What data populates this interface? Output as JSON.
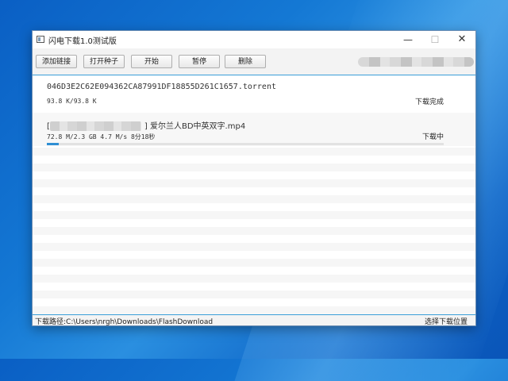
{
  "window": {
    "title": "闪电下载1.0测试版",
    "minimize_glyph": "—",
    "maximize_glyph": "☐",
    "close_glyph": "✕"
  },
  "toolbar": {
    "buttons": [
      "添加链接",
      "打开种子",
      "开始",
      "暂停",
      "删除"
    ]
  },
  "downloads": [
    {
      "name": "046D3E2C62E094362CA87991DF18855D261C1657.torrent",
      "meta": "93.8 K/93.8 K",
      "status": "下载完成"
    },
    {
      "name_prefix": "[",
      "name_suffix": "] 爱尔兰人BD中英双字.mp4",
      "meta": "72.8 M/2.3 GB  4.7 M/s  8分18秒",
      "status": "下载中",
      "progress": 0.03
    }
  ],
  "statusbar": {
    "path": "下载路径:C:\\Users\\nrgh\\Downloads\\FlashDownload",
    "choose_label": "选择下载位置"
  },
  "colors": {
    "accent": "#3a9ed8",
    "progress": "#2f8fd4",
    "desktop": "#1478d4"
  }
}
